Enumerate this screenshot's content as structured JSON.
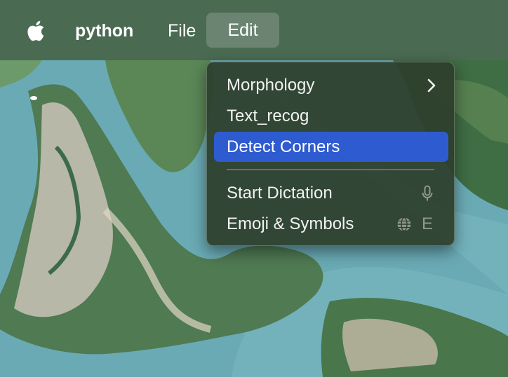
{
  "menubar": {
    "apple_icon": "apple-icon",
    "app_name": "python",
    "menus": [
      "File",
      "Edit"
    ],
    "active_menu": "Edit"
  },
  "edit_menu": {
    "items": [
      {
        "label": "Morphology",
        "submenu": true
      },
      {
        "label": "Text_recog"
      },
      {
        "label": "Detect Corners",
        "highlighted": true
      },
      {
        "label": "Start Dictation",
        "shortcut_icon": "mic-icon"
      },
      {
        "label": "Emoji & Symbols",
        "shortcut_icon": "globe-icon",
        "shortcut_key": "E"
      }
    ]
  },
  "colors": {
    "menubar": "#4a6a52",
    "highlight": "#2e5cd0",
    "menu_background": "#2e3e2c"
  }
}
